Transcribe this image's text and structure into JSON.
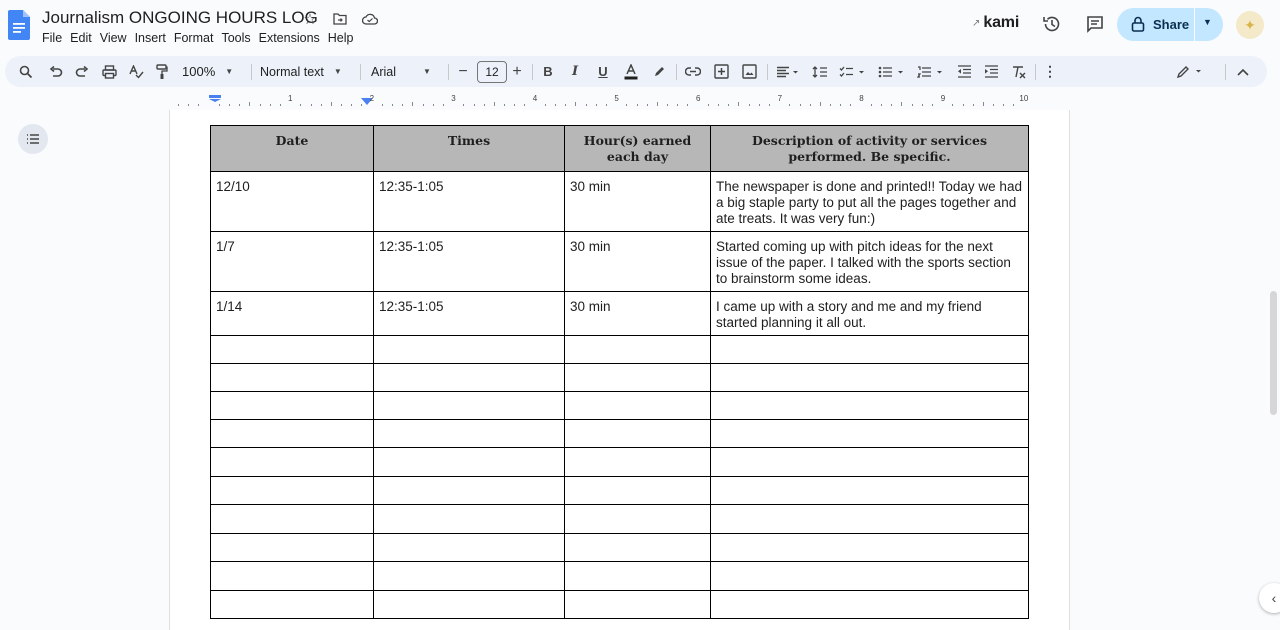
{
  "app": {
    "title": "Journalism ONGOING HOURS LOG",
    "menu": [
      "File",
      "Edit",
      "View",
      "Insert",
      "Format",
      "Tools",
      "Extensions",
      "Help"
    ]
  },
  "header": {
    "kami_label": "kami",
    "share_label": "Share"
  },
  "toolbar": {
    "zoom": "100%",
    "style": "Normal text",
    "font": "Arial",
    "font_size": "12"
  },
  "ruler": {
    "numbers": [
      "1",
      "2",
      "3",
      "4",
      "5",
      "6",
      "7",
      "8",
      "9",
      "10"
    ]
  },
  "table": {
    "headers": [
      "Date",
      "Times",
      "Hour(s) earned each day",
      "Description of activity or services performed. Be specific."
    ],
    "rows": [
      [
        "12/10",
        "12:35-1:05",
        "30 min",
        "The newspaper is done and printed!! Today we had a big staple party to put all the pages together and ate treats. It was very fun:)"
      ],
      [
        "1/7",
        "12:35-1:05",
        "30 min",
        "Started coming up with pitch ideas for the next issue of the paper. I talked with the sports section to brainstorm some ideas."
      ],
      [
        "1/14",
        "12:35-1:05",
        "30 min",
        "I came up with a story and me and my friend started planning it all out."
      ],
      [
        "",
        "",
        "",
        ""
      ],
      [
        "",
        "",
        "",
        ""
      ],
      [
        "",
        "",
        "",
        ""
      ],
      [
        "",
        "",
        "",
        ""
      ],
      [
        "",
        "",
        "",
        ""
      ],
      [
        "",
        "",
        "",
        ""
      ],
      [
        "",
        "",
        "",
        ""
      ],
      [
        "",
        "",
        "",
        ""
      ],
      [
        "",
        "",
        "",
        ""
      ],
      [
        "",
        "",
        "",
        ""
      ]
    ]
  },
  "colors": {
    "background": "#f9fbfd",
    "toolbar": "#edf2fa",
    "share_button": "#c2e7ff",
    "header_cell": "#b7b7b7",
    "doc_logo": "#4285f4"
  },
  "icons": {
    "logo": "google-docs-icon",
    "star": "star-icon",
    "move": "folder-move-icon",
    "cloud": "cloud-saved-icon",
    "history": "history-icon",
    "comments": "comments-icon",
    "lock": "lock-icon"
  }
}
